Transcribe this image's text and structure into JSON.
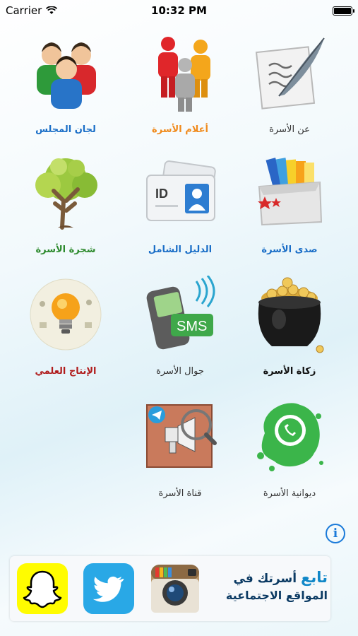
{
  "status_bar": {
    "carrier": "Carrier",
    "time": "10:32 PM"
  },
  "tiles": [
    {
      "label": "عن الأسرة",
      "icon": "quill-paper-icon",
      "color": "#333333"
    },
    {
      "label": "أعلام الأسرة",
      "icon": "people-figures-icon",
      "color": "#f08a1c"
    },
    {
      "label": "لجان المجلس",
      "icon": "council-group-icon",
      "color": "#1a6ec7"
    },
    {
      "label": "صدى الأسرة",
      "icon": "folders-box-icon",
      "color": "#1a6ec7"
    },
    {
      "label": "الدليل الشامل",
      "icon": "id-card-icon",
      "color": "#1a6ec7"
    },
    {
      "label": "شجرة الأسرة",
      "icon": "family-tree-icon",
      "color": "#2d8a2d"
    },
    {
      "label": "زكاة الأسرة",
      "icon": "gold-pot-icon",
      "color": "#111111"
    },
    {
      "label": "جوال الأسرة",
      "icon": "sms-phone-icon",
      "color": "#333333"
    },
    {
      "label": "الإنتاج العلمي",
      "icon": "lightbulb-icon",
      "color": "#b01c1c"
    },
    {
      "label": "ديوانية الأسرة",
      "icon": "whatsapp-splash-icon",
      "color": "#333333"
    },
    {
      "label": "قناة الأسرة",
      "icon": "telegram-channel-icon",
      "color": "#333333"
    }
  ],
  "social": {
    "follow_accent": "تابع",
    "follow_rest": "أسرتك في",
    "follow_line2": "المواقع الاجتماعية",
    "buttons": [
      {
        "name": "instagram",
        "icon": "instagram-icon"
      },
      {
        "name": "twitter",
        "icon": "twitter-icon"
      },
      {
        "name": "snapchat",
        "icon": "snapchat-icon"
      }
    ]
  },
  "info_symbol": "i"
}
